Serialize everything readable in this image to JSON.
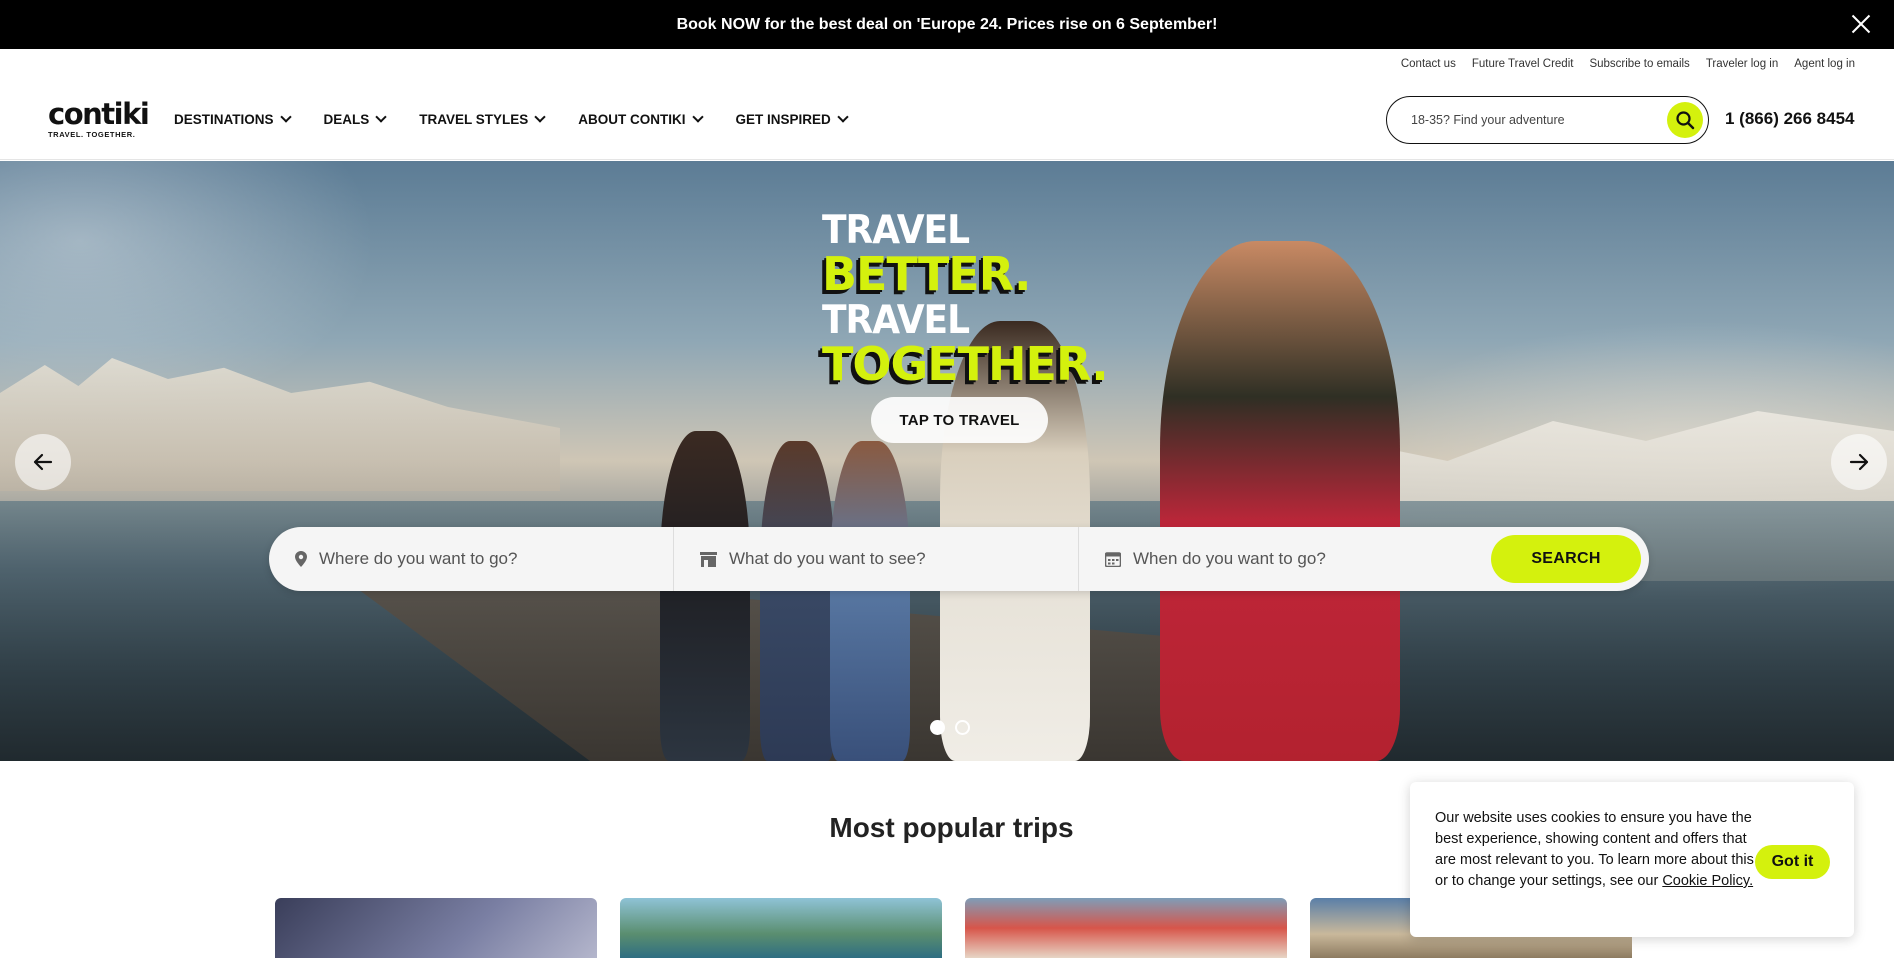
{
  "promo": {
    "text": "Book NOW for the best deal on 'Europe 24. Prices rise on 6 September!"
  },
  "utility": {
    "links": [
      "Contact us",
      "Future Travel Credit",
      "Subscribe to emails",
      "Traveler log in",
      "Agent log in"
    ]
  },
  "logo": {
    "word": "contiki",
    "tagline": "TRAVEL. TOGETHER."
  },
  "nav": {
    "items": [
      "DESTINATIONS",
      "DEALS",
      "TRAVEL STYLES",
      "ABOUT CONTIKI",
      "GET INSPIRED"
    ]
  },
  "header_search": {
    "placeholder": "18-35? Find your adventure"
  },
  "phone": "1 (866) 266 8454",
  "hero": {
    "line1": "TRAVEL",
    "line2": "BETTER.",
    "line3": "TRAVEL",
    "line4": "TOGETHER.",
    "cta": "TAP TO TRAVEL"
  },
  "trip_search": {
    "where_placeholder": "Where do you want to go?",
    "what_placeholder": "What do you want to see?",
    "when_placeholder": "When do you want to go?",
    "button": "SEARCH"
  },
  "popular": {
    "title": "Most popular trips"
  },
  "cookie": {
    "text": "Our website uses cookies to ensure you have the best experience, showing content and offers that are most relevant to you. To learn more about this or to change your settings, see our",
    "link": "Cookie Policy.",
    "button": "Got it"
  },
  "colors": {
    "accent": "#d4f10d",
    "dark": "#000000"
  }
}
